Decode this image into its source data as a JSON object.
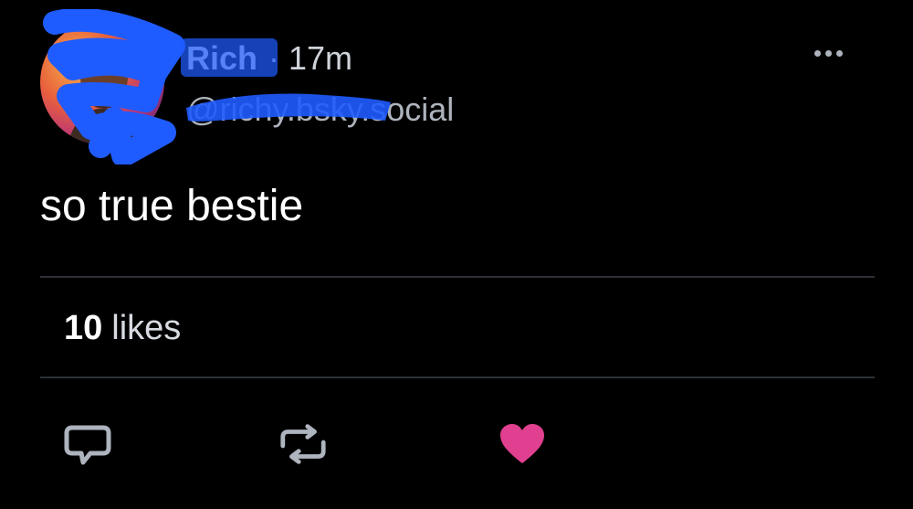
{
  "post": {
    "author": {
      "display_name": "Rich",
      "handle": "@richy.bsky.social",
      "avatar_icon": "avatar-photo"
    },
    "separator": "·",
    "time_ago": "17m",
    "text": "so true bestie",
    "more_icon": "ellipsis-icon"
  },
  "stats": {
    "likes_count": "10",
    "likes_label": "likes"
  },
  "actions": {
    "reply_icon": "reply-icon",
    "repost_icon": "repost-icon",
    "like_icon": "heart-icon",
    "like_active": true
  },
  "colors": {
    "background": "#000000",
    "redaction": "#1f5cff",
    "like": "#e0408f",
    "icon_gray": "#aeb4bd"
  }
}
